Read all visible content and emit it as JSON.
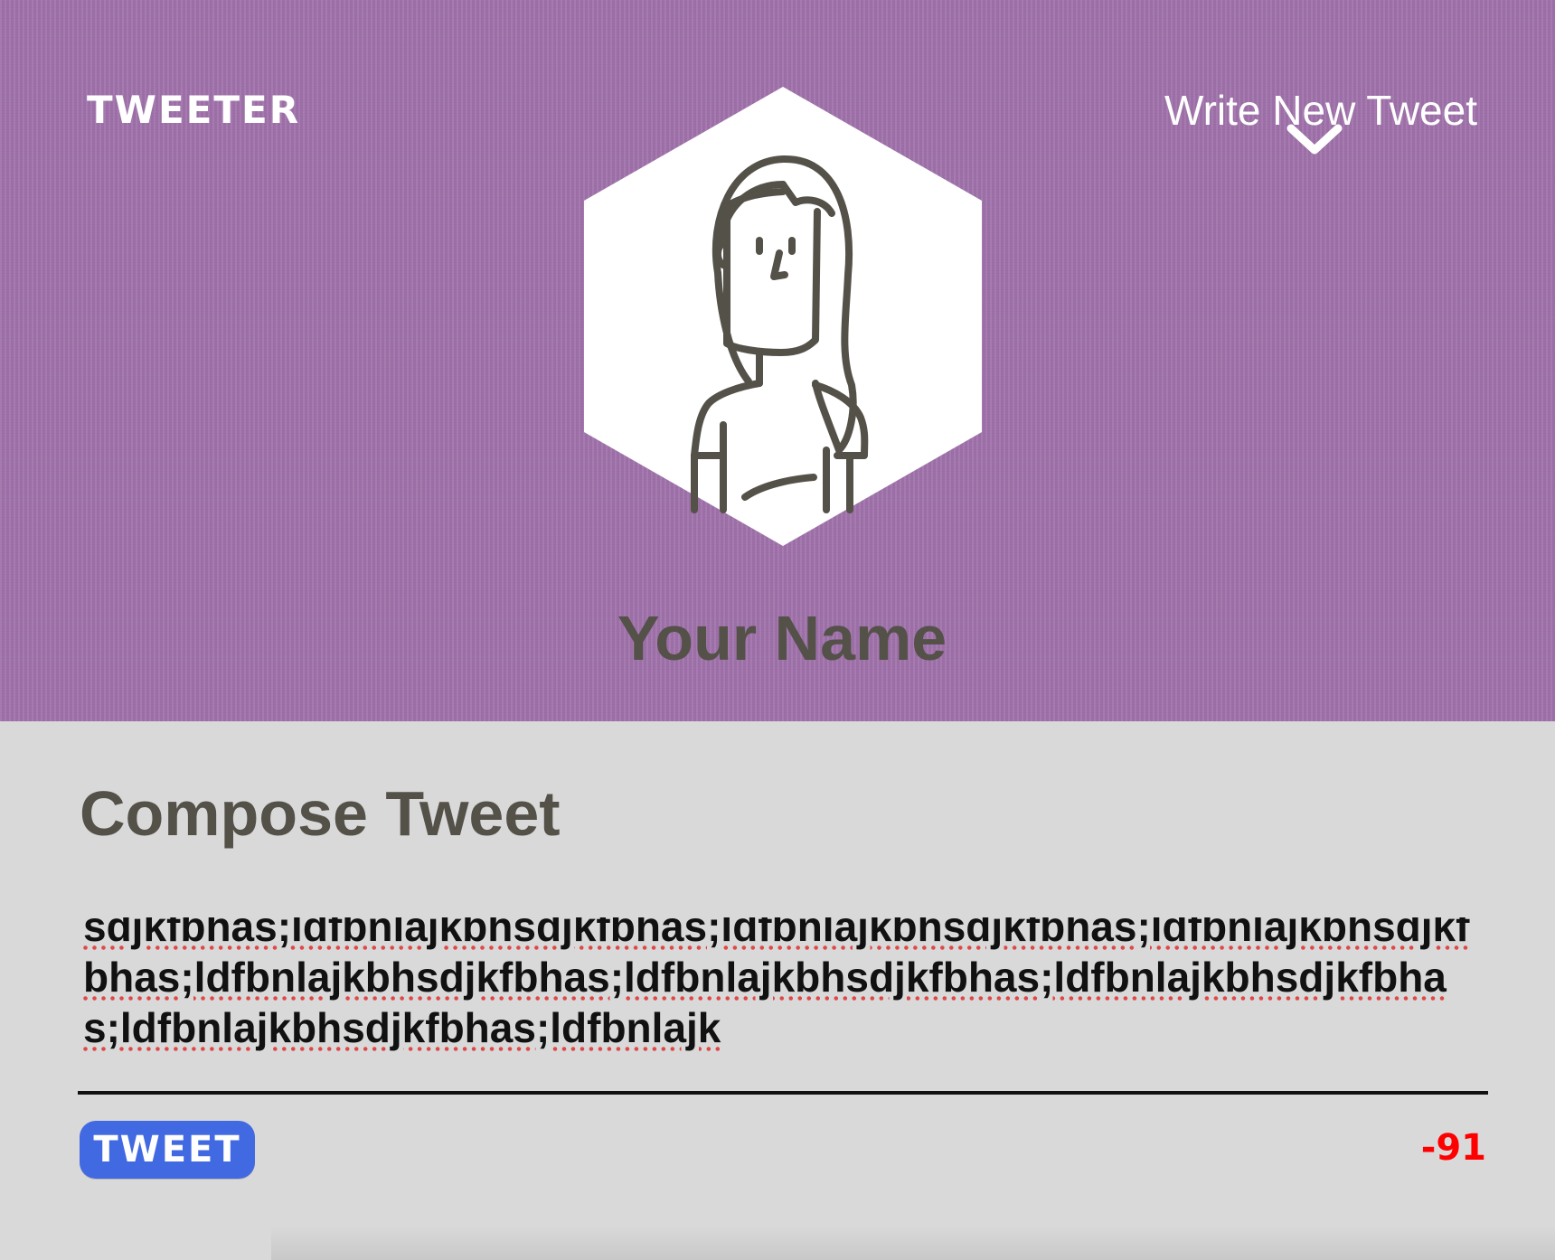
{
  "header": {
    "logo_text": "TWEETER",
    "write_link_label": "Write New Tweet",
    "user_name": "Your Name"
  },
  "compose": {
    "title": "Compose Tweet",
    "tweet_text": "sdjkfbhas;ldfbnlajkbhsdjkfbhas;ldfbnlajkbhsdjkfbhas;ldfbnlajkbhsdjkfbhas;ldfbnlajkbhsdjkfbhas;ldfbnlajkbhsdjkfbhas;ldfbnlajkbhsdjkfbhas;ldfbnlajkbhsdjkfbhas;ldfbnlajk",
    "tweet_button_label": "TWEET",
    "char_counter": "-91"
  },
  "colors": {
    "header_bg": "#a274ad",
    "body_bg": "#d9d9d9",
    "button_bg": "#4169e1",
    "counter_over_limit": "#ff0000",
    "heading_text": "#545149"
  },
  "icons": {
    "nav_toggle": "chevron-down-icon",
    "avatar": "avatar-woman-icon"
  }
}
